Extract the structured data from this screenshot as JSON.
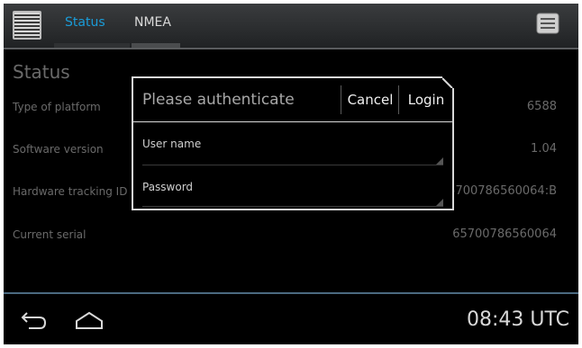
{
  "tabs": [
    {
      "label": "Status",
      "active": true
    },
    {
      "label": "NMEA",
      "active": false
    }
  ],
  "icons": {
    "menu": "menu-list-icon",
    "overflow": "overflow-menu-icon",
    "back": "back-arrow-icon",
    "home": "home-icon"
  },
  "status": {
    "title": "Status",
    "rows": [
      {
        "label": "Type of platform",
        "value": "6588"
      },
      {
        "label": "Software version",
        "value": "1.04"
      },
      {
        "label": "Hardware tracking ID",
        "value": "65700786560064:B"
      },
      {
        "label": "Current serial",
        "value": "65700786560064"
      }
    ]
  },
  "dialog": {
    "title": "Please authenticate",
    "cancel_label": "Cancel",
    "login_label": "Login",
    "username_label": "User name",
    "username_value": "",
    "password_label": "Password",
    "password_value": ""
  },
  "clock": "08:43 UTC",
  "colors": {
    "active_tab": "#1a9cd8",
    "background": "#000000",
    "dialog_border": "#d9d9d9"
  }
}
